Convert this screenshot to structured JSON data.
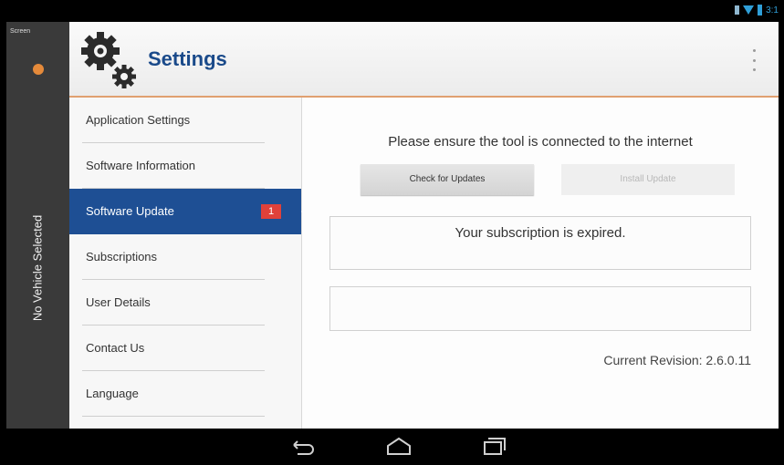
{
  "status_bar": {
    "icons": [
      "sim-icon",
      "wifi-icon",
      "battery-icon"
    ],
    "time": "3:1"
  },
  "rail": {
    "top_label": "Screen",
    "vehicle_label": "No Vehicle Selected",
    "dot_color": "#e58a3a"
  },
  "header": {
    "title": "Settings",
    "icon": "gears-icon",
    "menu_icon": "overflow-menu-icon",
    "accent_line_color": "#e0a070"
  },
  "sidebar": {
    "items": [
      {
        "label": "Application Settings"
      },
      {
        "label": "Software Information"
      },
      {
        "label": "Software Update",
        "active": true,
        "badge": "1"
      },
      {
        "label": "Subscriptions"
      },
      {
        "label": "User Details"
      },
      {
        "label": "Contact Us"
      },
      {
        "label": "Language"
      }
    ],
    "active_color": "#1e4f94",
    "badge_color": "#e0413a"
  },
  "content": {
    "notice": "Please ensure the tool is connected to the internet",
    "check_button": "Check for Updates",
    "install_button": "Install Update",
    "status_message": "Your subscription is expired.",
    "revision": "Current Revision: 2.6.0.11"
  },
  "navbar": {
    "icons": [
      "back-icon",
      "home-icon",
      "recent-apps-icon"
    ]
  }
}
